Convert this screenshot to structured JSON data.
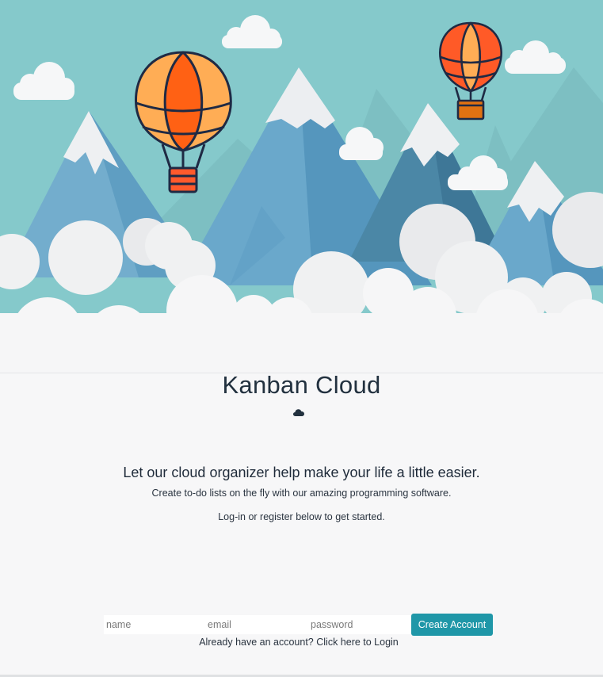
{
  "page": {
    "title": "Kanban Cloud",
    "tagline": "Let our cloud organizer help make your life a little easier.",
    "description_line1": "Create to-do lists on the fly with our amazing programming software.",
    "description_line2": "Log-in or register below to get started."
  },
  "icons": {
    "logo": "cloud-icon"
  },
  "form": {
    "name_placeholder": "name",
    "email_placeholder": "email",
    "password_placeholder": "password",
    "submit_label": "Create Account",
    "login_link_text": "Already have an account? Click here to Login"
  },
  "colors": {
    "sky": "#85c9cb",
    "accent_button": "#1f97a8",
    "title_text": "#22313f",
    "balloon_orange": "#ff6a13",
    "balloon_light": "#ffb259"
  }
}
